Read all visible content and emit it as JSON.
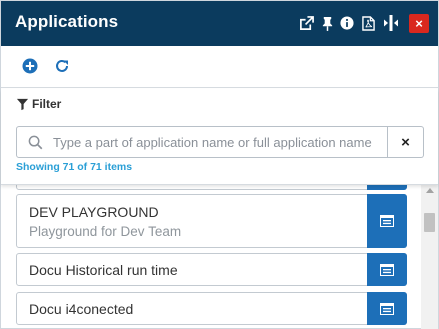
{
  "header": {
    "title": "Applications",
    "icons": [
      "external-link-icon",
      "pin-icon",
      "info-icon",
      "pdf-icon",
      "resize-icon",
      "close-icon"
    ],
    "close_glyph": "×",
    "accent_color": "#0b3b5e",
    "close_color": "#d9281e"
  },
  "toolbar": {
    "icons": [
      "add-icon",
      "refresh-icon"
    ],
    "icon_color": "#1d6fb8"
  },
  "filter": {
    "label": "Filter",
    "search_placeholder": "Type a part of application name or full application name",
    "search_value": "",
    "clear_glyph": "×",
    "count_text": "Showing 71 of 71 items"
  },
  "applications": [
    {
      "name": "DEV PLAYGROUND",
      "description": "Playground for Dev Team"
    },
    {
      "name": "Docu Historical run time",
      "description": ""
    },
    {
      "name": "Docu i4conected",
      "description": ""
    }
  ],
  "colors": {
    "button_blue": "#1d6fb8",
    "count_text": "#2a9fd6"
  }
}
